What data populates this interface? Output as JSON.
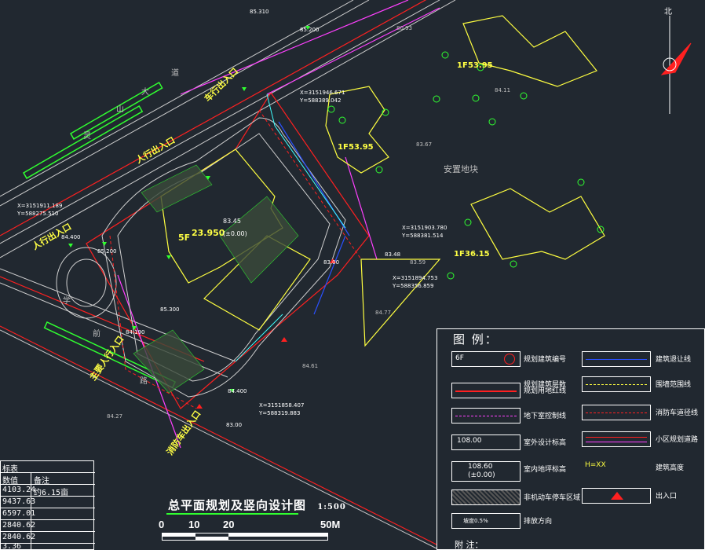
{
  "drawing": {
    "title": "总平面规划及竖向设计图",
    "scale_ratio": "1:500",
    "scale_bar": [
      "0",
      "10",
      "20",
      "50M"
    ]
  },
  "street_labels": {
    "road_big": [
      "大",
      "山",
      "道",
      "灵"
    ],
    "road_xue": [
      "学",
      "前",
      "路"
    ],
    "anzhi": "安置地块"
  },
  "entrances": {
    "pedestrian_1": "人行出入口",
    "pedestrian_2": "人行出入口",
    "car_exit": "车行出入口",
    "ped_main": "主要人行入口",
    "fire_1": "消防出入口",
    "fire_2": "消防车出入口"
  },
  "coordinates": [
    {
      "x": "X=3151911.189",
      "y": "Y=588275.510"
    },
    {
      "x": "X=3151946.671",
      "y": "Y=588389.042"
    },
    {
      "x": "X=3151903.780",
      "y": "Y=588381.514"
    },
    {
      "x": "X=3151894.753",
      "y": "Y=588356.859"
    },
    {
      "x": "X=3151858.407",
      "y": "Y=588319.883"
    }
  ],
  "building": {
    "floors": "5F",
    "height": "23.950",
    "elev_main": "83.45",
    "elev_sub": "(±0.00)"
  },
  "neighbors": [
    {
      "floors": "1F",
      "height": "53.95"
    },
    {
      "floors": "1F",
      "height": "53.95"
    },
    {
      "floors": "1F",
      "height": "36.15"
    }
  ],
  "spot_elevations": [
    "85.200",
    "85.310",
    "84.400",
    "85.200",
    "85.300",
    "84.190",
    "84.400",
    "83.00",
    "80.93",
    "84.11",
    "83.67",
    "83.59",
    "83.48",
    "84.77",
    "84.27",
    "83.00",
    "84.61"
  ],
  "legend": {
    "title": "图 例：",
    "items": [
      {
        "label": "规划建筑编号"
      },
      {
        "label": "建筑退让线"
      },
      {
        "label": "规划建筑层数"
      },
      {
        "label": "围墙范围线"
      },
      {
        "label": "规划用地红线"
      },
      {
        "label": "消防车道径线"
      },
      {
        "label": "地下室控制线"
      },
      {
        "label": "小区规划道路"
      },
      {
        "label": "室外设计标高"
      },
      {
        "label": "建筑高度"
      },
      {
        "label": "室内地坪标高"
      },
      {
        "label": "出入口"
      },
      {
        "label": "非机动车停车区域"
      },
      {
        "label": "排放方向"
      }
    ],
    "sample_texts": {
      "floors": "6F",
      "elev": "108.00",
      "elev_in": "108.60",
      "elev_in_sub": "(±0.00)",
      "slope": "坡度0.5%",
      "height_tag": "H=XX"
    },
    "notes_label": "附 注："
  },
  "table": {
    "header": "标表",
    "col_headers": [
      "数值",
      "备注"
    ],
    "rows": [
      {
        "v": "4103.24",
        "note": "约6.15亩"
      },
      {
        "v": "9437.63",
        "note": ""
      },
      {
        "v": "6597.01",
        "note": ""
      },
      {
        "v": "2840.62",
        "note": ""
      },
      {
        "v": "2840.62",
        "note": ""
      },
      {
        "v": "3.36",
        "note": ""
      }
    ]
  },
  "north_arrow": "北",
  "colors": {
    "background": "#212830",
    "red_line": "#ff2020",
    "magenta": "#ff40ff",
    "green": "#30ff30",
    "yellow": "#ffff40",
    "cyan": "#40ffff",
    "blue": "#2040ff"
  }
}
